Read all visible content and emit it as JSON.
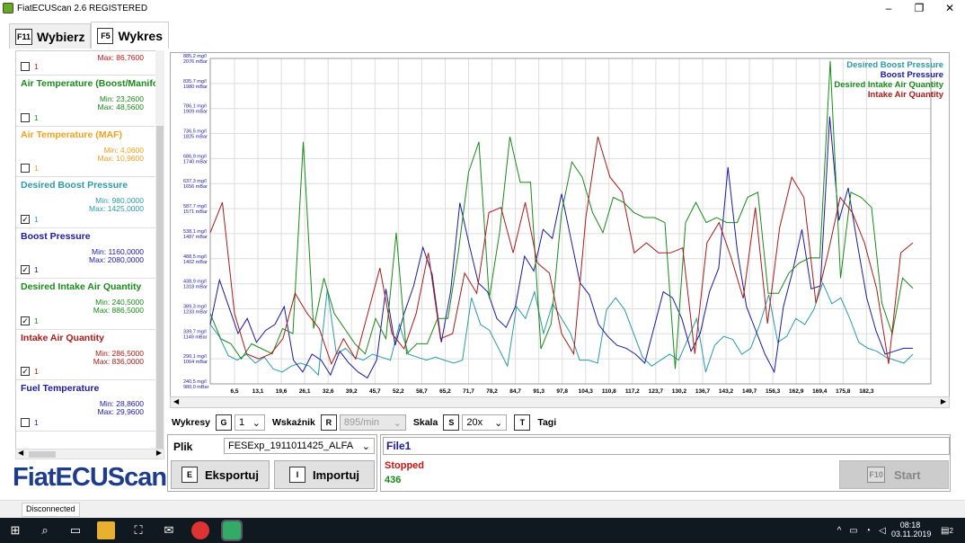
{
  "window": {
    "title": "FiatECUScan 2.6 REGISTERED",
    "minimize": "–",
    "maximize": "❐",
    "close": "✕"
  },
  "tabs": [
    {
      "key": "F11",
      "label": "Wybierz"
    },
    {
      "key": "F5",
      "label": "Wykres"
    }
  ],
  "sidebar": {
    "partial_top": {
      "max": "Max: 86,7600",
      "checked_num": "1",
      "color": "#cc1111"
    },
    "sensors": [
      {
        "name": "Air Temperature (Boost/Manifo",
        "min": "Min: 23,2600",
        "max": "Max: 48,5600",
        "checked": false,
        "num": "1",
        "color": "#1a8a1a"
      },
      {
        "name": "Air Temperature (MAF)",
        "min": "Min: 4,0600",
        "max": "Max: 10,9600",
        "checked": false,
        "num": "1",
        "color": "#f0a020"
      },
      {
        "name": "Desired Boost Pressure",
        "min": "Min: 980,0000",
        "max": "Max: 1425,0000",
        "checked": true,
        "num": "1",
        "color": "#2a9aa8"
      },
      {
        "name": "Boost Pressure",
        "min": "Min: 1160,0000",
        "max": "Max: 2080,0000",
        "checked": true,
        "num": "1",
        "color": "#1a1aa0"
      },
      {
        "name": "Desired Intake Air Quantity",
        "min": "Min: 240,5000",
        "max": "Max: 886,5000",
        "checked": true,
        "num": "1",
        "color": "#1a8a1a"
      },
      {
        "name": "Intake Air Quantity",
        "min": "Min: 286,5000",
        "max": "Max: 836,0000",
        "checked": true,
        "num": "1",
        "color": "#aa1a1a"
      },
      {
        "name": "Fuel Temperature",
        "min": "Min: 28,8600",
        "max": "Max: 29,9600",
        "checked": false,
        "num": "1",
        "color": "#1a1aa0"
      }
    ]
  },
  "logo": "FiatECUScan",
  "chart_data": {
    "type": "line",
    "xticks": [
      "6,5",
      "13,1",
      "19,6",
      "26,1",
      "32,6",
      "39,2",
      "45,7",
      "52,2",
      "58,7",
      "65,2",
      "71,7",
      "78,2",
      "84,7",
      "91,3",
      "97,8",
      "104,3",
      "110,8",
      "117,2",
      "123,7",
      "130,2",
      "136,7",
      "143,2",
      "149,7",
      "156,3",
      "162,9",
      "169,4",
      "175,8",
      "182,3"
    ],
    "y_labels_mg": [
      "885,2 mg/l",
      "835,7 mg/l",
      "786,1 mg/l",
      "736,5 mg/l",
      "686,9 mg/l",
      "637,3 mg/l",
      "587,7 mg/l",
      "538,1 mg/l",
      "488,5 mg/l",
      "438,9 mg/l",
      "389,3 mg/l",
      "339,7 mg/l",
      "290,1 mg/l",
      "240,5 mg/l"
    ],
    "y_labels_mbar": [
      "2076 mBar",
      "1980 mBar",
      "1909 mBar",
      "1825 mBar",
      "1740 mBar",
      "1656 mBar",
      "1571 mBar",
      "1487 mBar",
      "1402 mBar",
      "1318 mBar",
      "1233 mBar",
      "1149 mBar",
      "1064 mBar",
      "980,0 mBar"
    ],
    "legend": [
      "Desired Boost Pressure",
      "Boost Pressure",
      "Desired Intake Air Quantity",
      "Intake Air Quantity"
    ],
    "series": [
      {
        "name": "Desired Boost Pressure",
        "color": "#2a9aa8",
        "values": [
          1180,
          1140,
          1075,
          1060,
          1080,
          1050,
          1070,
          1030,
          1020,
          1040,
          1050,
          1040,
          1010,
          1300,
          1080,
          1100,
          1070,
          1060,
          1080,
          1070,
          1060,
          1180,
          1080,
          1070,
          1060,
          1070,
          1060,
          1050,
          1060,
          1270,
          1180,
          1160,
          1100,
          1040,
          1240,
          1200,
          1290,
          1150,
          1250,
          1200,
          1150,
          1060,
          1060,
          1050,
          1230,
          1270,
          1230,
          1150,
          1070,
          1040,
          1060,
          1080,
          1060,
          1130,
          1200,
          1020,
          1110,
          1140,
          1130,
          1080,
          1100,
          1180,
          1280,
          1120,
          1140,
          1200,
          1180,
          1230,
          1320,
          1250,
          1270,
          1200,
          1120,
          1100,
          1090,
          1070,
          1060,
          1050,
          1080
        ]
      },
      {
        "name": "Boost Pressure",
        "color": "#1a1aa0",
        "values": [
          1180,
          1330,
          1240,
          1150,
          1200,
          1120,
          1160,
          1180,
          1240,
          1060,
          1020,
          1080,
          1060,
          1010,
          1090,
          1050,
          1020,
          1000,
          1060,
          1300,
          1110,
          1220,
          1310,
          1440,
          1350,
          1120,
          1290,
          1590,
          1450,
          1320,
          1290,
          1200,
          1170,
          1240,
          1410,
          1360,
          1500,
          1470,
          1620,
          1470,
          1320,
          1280,
          1180,
          1140,
          1110,
          1100,
          1080,
          1050,
          1170,
          1290,
          1270,
          1200,
          1090,
          1150,
          1290,
          1370,
          1710,
          1430,
          1240,
          1160,
          1080,
          1020,
          1240,
          1360,
          1500,
          1300,
          1310,
          1880,
          1530,
          1640,
          1450,
          1270,
          1160,
          1080,
          1090,
          1100,
          1100
        ]
      },
      {
        "name": "Desired Intake Air Quantity",
        "color": "#1a8a1a",
        "values": [
          380,
          330,
          320,
          290,
          320,
          310,
          300,
          350,
          340,
          720,
          350,
          450,
          380,
          350,
          320,
          300,
          370,
          330,
          540,
          300,
          320,
          320,
          370,
          370,
          500,
          660,
          720,
          410,
          540,
          730,
          640,
          640,
          310,
          360,
          580,
          680,
          650,
          580,
          540,
          610,
          600,
          580,
          570,
          570,
          560,
          270,
          560,
          600,
          560,
          570,
          560,
          560,
          610,
          620,
          420,
          420,
          460,
          480,
          490,
          490,
          880,
          450,
          620,
          610,
          590,
          400,
          340,
          450,
          430
        ]
      },
      {
        "name": "Intake Air Quantity",
        "color": "#aa1a1a",
        "values": [
          540,
          600,
          380,
          300,
          290,
          300,
          330,
          420,
          380,
          350,
          280,
          330,
          290,
          380,
          470,
          340,
          310,
          380,
          500,
          330,
          340,
          460,
          420,
          580,
          590,
          500,
          600,
          480,
          460,
          340,
          300,
          570,
          730,
          650,
          620,
          500,
          520,
          500,
          500,
          510,
          300,
          520,
          560,
          490,
          410,
          590,
          360,
          550,
          650,
          610,
          400,
          500,
          610,
          580,
          520,
          430,
          280,
          500,
          520
        ]
      }
    ]
  },
  "controls": {
    "wykresy_label": "Wykresy",
    "g_key": "G",
    "g_value": "1",
    "wskaznik_label": "Wskaźnik",
    "r_key": "R",
    "r_value": "895/min",
    "skala_label": "Skala",
    "s_key": "S",
    "s_value": "20x",
    "t_key": "T",
    "tagi_label": "Tagi"
  },
  "file_panel": {
    "plik_label": "Plik",
    "file_value": "FESExp_1911011425_ALFA",
    "export_key": "E",
    "export_label": "Eksportuj",
    "import_key": "I",
    "import_label": "Importuj"
  },
  "status_panel": {
    "file_name": "File1",
    "state": "Stopped",
    "count": "436",
    "start_key": "F10",
    "start_label": "Start"
  },
  "statusbar": {
    "connection": "Disconnected"
  },
  "taskbar": {
    "time": "08:18",
    "date": "03.11.2019",
    "notif_count": "2"
  }
}
